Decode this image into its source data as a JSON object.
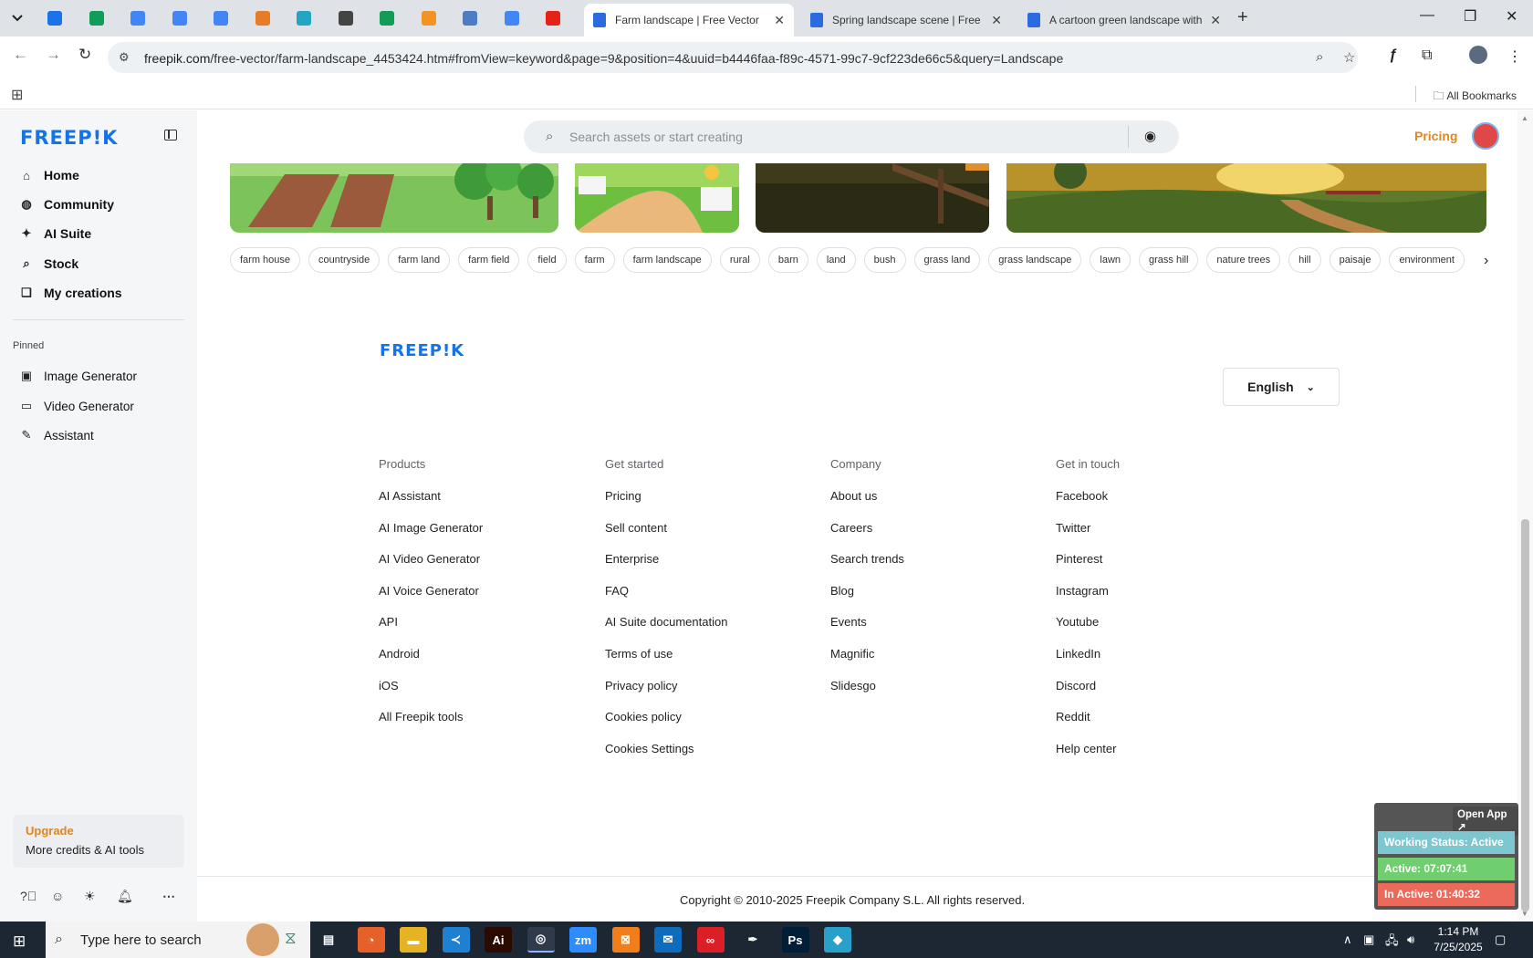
{
  "browser": {
    "pinned_tab_colors": [
      "#1a73e8",
      "#0f9d58",
      "#4285f4",
      "#4285f4",
      "#4285f4",
      "#e67c25",
      "#25a5c4",
      "#444444",
      "#0f9d58",
      "#f29424",
      "#4b7cc4",
      "#4285f4",
      "#e62117"
    ],
    "tabs": [
      {
        "title": "Farm landscape | Free Vector",
        "active": true
      },
      {
        "title": "Spring landscape scene | Free V",
        "active": false
      },
      {
        "title": "A cartoon green landscape with",
        "active": false
      }
    ],
    "url_host": "freepik.com",
    "url_path": "/free-vector/farm-landscape_4453424.htm#fromView=keyword&page=9&position=4&uuid=b4446faa-f89c-4571-99c7-9cf223de66c5&query=Landscape",
    "all_bookmarks": "All Bookmarks"
  },
  "sidebar": {
    "logo": "FREEP!K",
    "nav": [
      {
        "label": "Home",
        "icon": "home-icon"
      },
      {
        "label": "Community",
        "icon": "globe-icon"
      },
      {
        "label": "AI Suite",
        "icon": "sparkle-icon"
      },
      {
        "label": "Stock",
        "icon": "search-icon"
      },
      {
        "label": "My creations",
        "icon": "layers-icon"
      }
    ],
    "pinned_label": "Pinned",
    "pinned": [
      {
        "label": "Image Generator",
        "icon": "image-icon"
      },
      {
        "label": "Video Generator",
        "icon": "video-icon"
      },
      {
        "label": "Assistant",
        "icon": "chat-icon"
      }
    ],
    "upgrade_title": "Upgrade",
    "upgrade_sub": "More credits & AI tools"
  },
  "topbar": {
    "search_placeholder": "Search assets or start creating",
    "pricing": "Pricing"
  },
  "tags": [
    "farm house",
    "countryside",
    "farm land",
    "farm field",
    "field",
    "farm",
    "farm landscape",
    "rural",
    "barn",
    "land",
    "bush",
    "grass land",
    "grass landscape",
    "lawn",
    "grass hill",
    "nature trees",
    "hill",
    "paisaje",
    "environment"
  ],
  "footer": {
    "logo": "FREEP!K",
    "language": "English",
    "columns": [
      {
        "heading": "Products",
        "links": [
          "AI Assistant",
          "AI Image Generator",
          "AI Video Generator",
          "AI Voice Generator",
          "API",
          "Android",
          "iOS",
          "All Freepik tools"
        ]
      },
      {
        "heading": "Get started",
        "links": [
          "Pricing",
          "Sell content",
          "Enterprise",
          "FAQ",
          "AI Suite documentation",
          "Terms of use",
          "Privacy policy",
          "Cookies policy",
          "Cookies Settings"
        ]
      },
      {
        "heading": "Company",
        "links": [
          "About us",
          "Careers",
          "Search trends",
          "Blog",
          "Events",
          "Magnific",
          "Slidesgo"
        ]
      },
      {
        "heading": "Get in touch",
        "links": [
          "Facebook",
          "Twitter",
          "Pinterest",
          "Instagram",
          "Youtube",
          "LinkedIn",
          "Discord",
          "Reddit",
          "Help center"
        ]
      }
    ],
    "copyright": "Copyright © 2010-2025 Freepik Company S.L. All rights reserved."
  },
  "widget": {
    "open_app": "Open App ↗",
    "working_status": "Working Status: Active",
    "active": "Active: 07:07:41",
    "inactive": "In Active: 01:40:32",
    "colors": {
      "status": "#7fc7d0",
      "active": "#6fcf6f",
      "inactive": "#ec6a5c"
    }
  },
  "taskbar": {
    "search_placeholder": "Type here to search",
    "apps": [
      {
        "label": "",
        "icon": "task-view-icon",
        "color": "#1d2633"
      },
      {
        "label": "",
        "icon": "firefox-icon",
        "color": "#e6612a"
      },
      {
        "label": "",
        "icon": "file-explorer-icon",
        "color": "#e6b422"
      },
      {
        "label": "",
        "icon": "vscode-icon",
        "color": "#1f7fd1"
      },
      {
        "label": "Ai",
        "icon": "illustrator-icon",
        "color": "#2b0a00"
      },
      {
        "label": "",
        "icon": "chrome-icon",
        "color": "#2f3a4a"
      },
      {
        "label": "zm",
        "icon": "zoom-icon",
        "color": "#2d8cff"
      },
      {
        "label": "",
        "icon": "xampp-icon",
        "color": "#f07f1b"
      },
      {
        "label": "",
        "icon": "outlook-icon",
        "color": "#0f6cbd"
      },
      {
        "label": "",
        "icon": "creative-cloud-icon",
        "color": "#da1f26"
      },
      {
        "label": "",
        "icon": "pen-tool-icon",
        "color": "#1d2633"
      },
      {
        "label": "Ps",
        "icon": "photoshop-icon",
        "color": "#001e36"
      },
      {
        "label": "",
        "icon": "app-icon",
        "color": "#29a0c9"
      }
    ],
    "time": "1:14 PM",
    "date": "7/25/2025"
  }
}
